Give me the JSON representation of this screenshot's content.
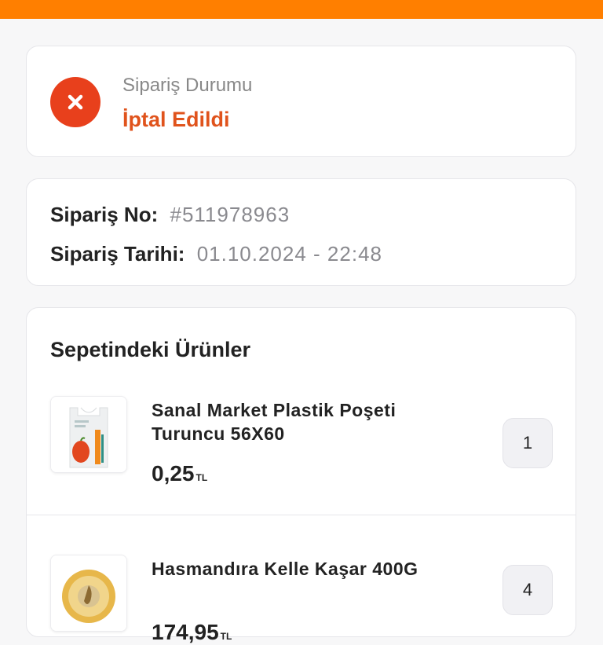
{
  "status": {
    "caption": "Sipariş Durumu",
    "value": "İptal Edildi",
    "icon": "close-icon"
  },
  "order": {
    "number_label": "Sipariş No:",
    "number_value": "#511978963",
    "date_label": "Sipariş Tarihi:",
    "date_value": "01.10.2024 - 22:48"
  },
  "products": {
    "title": "Sepetindeki Ürünler",
    "items": [
      {
        "name": "Sanal Market Plastik Poşeti Turuncu 56X60",
        "price": "0,25",
        "currency": "TL",
        "quantity": "1",
        "image": "plastic-bag-image"
      },
      {
        "name": "Hasmandıra Kelle Kaşar 400G",
        "price": "174,95",
        "currency": "TL",
        "quantity": "4",
        "image": "cheese-image"
      }
    ]
  },
  "colors": {
    "top_bar": "#ff7f00",
    "status_icon": "#e8401c",
    "status_text": "#e0531c"
  }
}
